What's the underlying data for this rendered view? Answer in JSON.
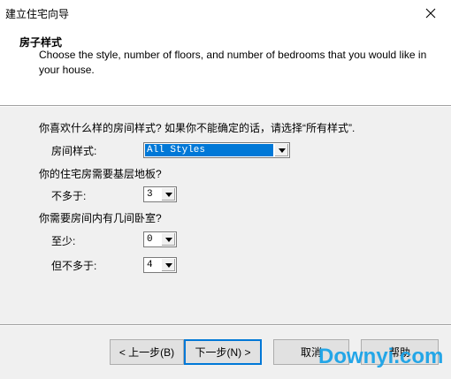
{
  "window": {
    "title": "建立住宅向导",
    "close_icon": "close-icon"
  },
  "header": {
    "title": "房子样式",
    "description": "Choose the style, number of floors, and number of bedrooms that you would like in your house."
  },
  "style_section": {
    "question": "你喜欢什么样的房间样式? 如果你不能确定的话，请选择“所有样式”.",
    "label": "房间样式:",
    "value": "All Styles"
  },
  "floors_section": {
    "question": "你的住宅房需要基层地板?",
    "label": "不多于:",
    "value": "3"
  },
  "bedrooms_section": {
    "question": "你需要房间内有几间卧室?",
    "min_label": "至少:",
    "min_value": "0",
    "max_label": "但不多于:",
    "max_value": "4"
  },
  "buttons": {
    "back": "< 上一步(B)",
    "next": "下一步(N) >",
    "cancel": "取消",
    "help": "帮助"
  },
  "watermark": "Downyi.com",
  "colors": {
    "selection": "#0078d7",
    "watermark": "#1aa3e8"
  }
}
